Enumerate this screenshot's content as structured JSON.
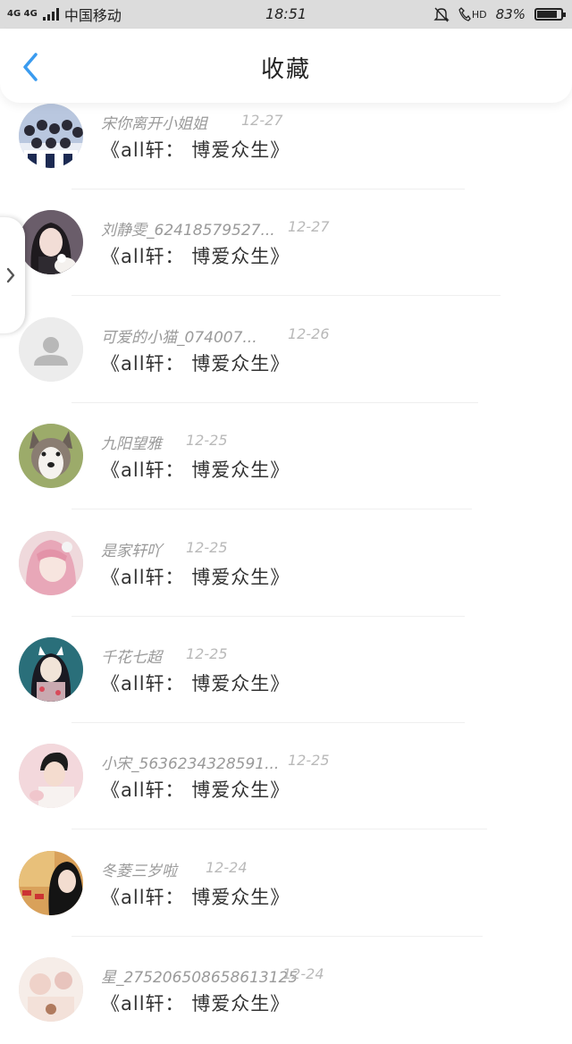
{
  "status_bar": {
    "network": "4G 4G",
    "carrier": "中国移动",
    "time": "18:51",
    "hd": "HD",
    "battery": "83%",
    "battery_level": 0.83
  },
  "header": {
    "title": "收藏",
    "back_icon": "chevron-left-icon",
    "accent_color": "#3a9bef"
  },
  "items": [
    {
      "name": "宋你离开小姐姐",
      "date": "12-27",
      "title": "《all轩： 博爱众生》",
      "avatar": "group-photo"
    },
    {
      "name": "刘静雯_62418579527...",
      "date": "12-27",
      "title": "《all轩： 博爱众生》",
      "avatar": "girl-with-cat"
    },
    {
      "name": "可爱的小猫_074007...",
      "date": "12-26",
      "title": "《all轩： 博爱众生》",
      "avatar": "default-user-icon"
    },
    {
      "name": "九阳望雅",
      "date": "12-25",
      "title": "《all轩： 博爱众生》",
      "avatar": "husky-dog"
    },
    {
      "name": "是家轩吖",
      "date": "12-25",
      "title": "《all轩： 博爱众生》",
      "avatar": "pink-hair-girl"
    },
    {
      "name": "千花七超",
      "date": "12-25",
      "title": "《all轩： 博爱众生》",
      "avatar": "anime-fox-mask"
    },
    {
      "name": "小宋_5636234328591...",
      "date": "12-25",
      "title": "《all轩： 博爱众生》",
      "avatar": "young-man"
    },
    {
      "name": "冬菱三岁啦",
      "date": "12-24",
      "title": "《all轩： 博爱众生》",
      "avatar": "girl-city"
    },
    {
      "name": "星_275206508658613125",
      "date": "12-24",
      "title": "《all轩： 博爱众生》",
      "avatar": "pastel-art"
    }
  ]
}
